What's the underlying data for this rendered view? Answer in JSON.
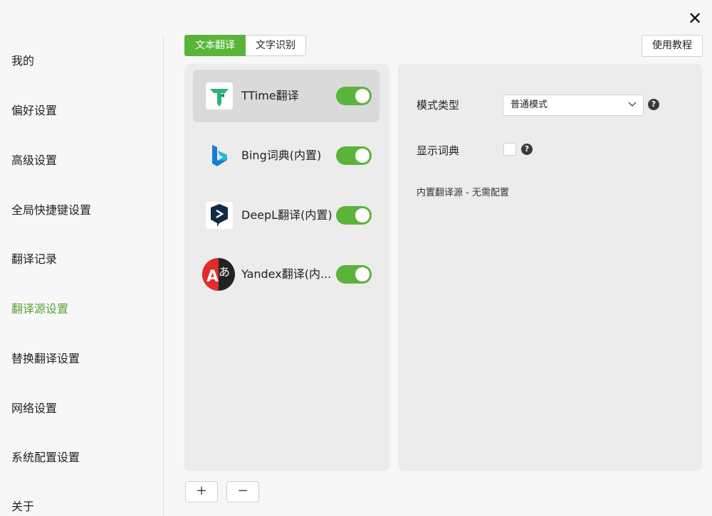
{
  "window": {
    "close_icon": "close-icon"
  },
  "sidebar": {
    "items": [
      {
        "label": "我的"
      },
      {
        "label": "偏好设置"
      },
      {
        "label": "高级设置"
      },
      {
        "label": "全局快捷键设置"
      },
      {
        "label": "翻译记录"
      },
      {
        "label": "翻译源设置",
        "active": true
      },
      {
        "label": "替换翻译设置"
      },
      {
        "label": "网络设置"
      },
      {
        "label": "系统配置设置"
      },
      {
        "label": "关于"
      }
    ]
  },
  "tabs": [
    {
      "label": "文本翻译",
      "active": true
    },
    {
      "label": "文字识别"
    }
  ],
  "tutorial_label": "使用教程",
  "services": [
    {
      "name": "TTime翻译",
      "enabled": true,
      "selected": true,
      "icon": "ttime-logo-icon"
    },
    {
      "name": "Bing词典(内置)",
      "enabled": true,
      "icon": "bing-logo-icon"
    },
    {
      "name": "DeepL翻译(内置)",
      "enabled": true,
      "icon": "deepl-logo-icon"
    },
    {
      "name": "Yandex翻译(内...",
      "enabled": true,
      "icon": "yandex-logo-icon"
    }
  ],
  "settings": {
    "mode_label": "模式类型",
    "mode_value": "普通模式",
    "dict_label": "显示词典",
    "dict_checked": false,
    "note": "内置翻译源 - 无需配置",
    "help_glyph": "?"
  },
  "buttons": {
    "add": "+",
    "remove": "−"
  },
  "colors": {
    "accent": "#5ab43a",
    "active_text": "#5aa52f"
  }
}
